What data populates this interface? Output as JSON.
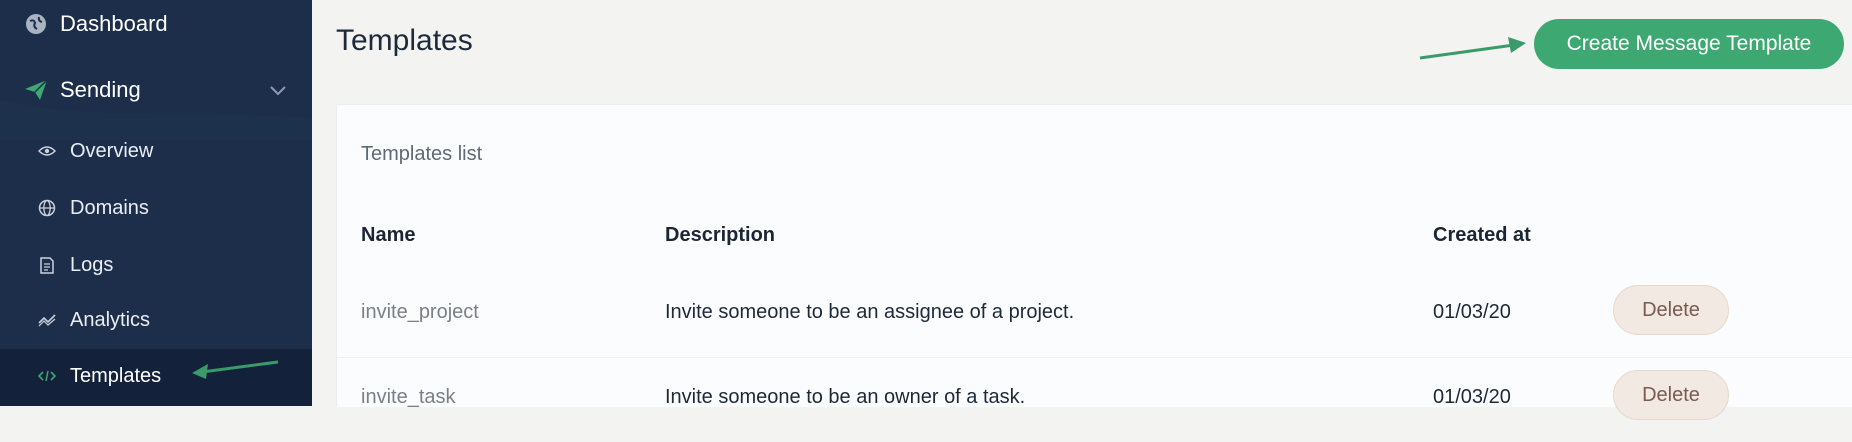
{
  "sidebar": {
    "dashboard": {
      "label": "Dashboard",
      "icon": "globe-icon"
    },
    "sending": {
      "label": "Sending",
      "icon": "paper-plane-icon"
    },
    "items": [
      {
        "label": "Overview",
        "icon": "eye-icon"
      },
      {
        "label": "Domains",
        "icon": "globe-icon"
      },
      {
        "label": "Logs",
        "icon": "document-icon"
      },
      {
        "label": "Analytics",
        "icon": "chart-icon"
      },
      {
        "label": "Templates",
        "icon": "code-icon",
        "active": true
      }
    ]
  },
  "header": {
    "title": "Templates",
    "create_button": "Create Message Template"
  },
  "card": {
    "title": "Templates list",
    "columns": [
      "Name",
      "Description",
      "Created at"
    ],
    "rows": [
      {
        "name": "invite_project",
        "description": "Invite someone to be an assignee of a project.",
        "created_at": "01/03/20",
        "action": "Delete"
      },
      {
        "name": "invite_task",
        "description": "Invite someone to be an owner of a task.",
        "created_at": "01/03/20",
        "action": "Delete"
      }
    ]
  },
  "colors": {
    "sidebar": "#1c2e4a",
    "accent_green": "#3ea873",
    "annotation_arrow": "#3a9a6a"
  }
}
